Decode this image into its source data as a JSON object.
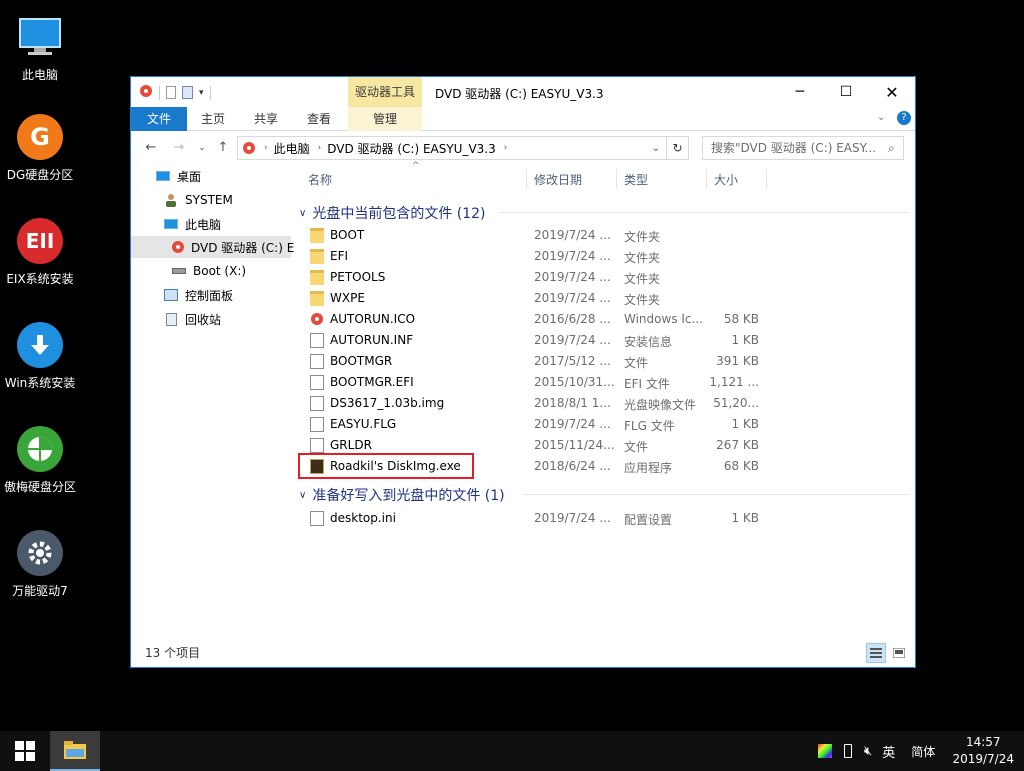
{
  "desktop": {
    "icons": [
      {
        "label": "此电脑",
        "icon": "this-pc-icon"
      },
      {
        "label": "DG硬盘分区",
        "icon": "dg-partition-icon"
      },
      {
        "label": "EIX系统安装",
        "icon": "eix-install-icon"
      },
      {
        "label": "Win系统安装",
        "icon": "win-install-icon"
      },
      {
        "label": "傲梅硬盘分区",
        "icon": "aomei-partition-icon"
      },
      {
        "label": "万能驱动7",
        "icon": "driver-gear-icon"
      }
    ]
  },
  "window": {
    "title": "DVD 驱动器 (C:) EASYU_V3.3",
    "context_tab": "驱动器工具",
    "ribbon_tabs": [
      "文件",
      "主页",
      "共享",
      "查看",
      "管理"
    ],
    "address": {
      "crumbs": [
        "此电脑",
        "DVD 驱动器 (C:) EASYU_V3.3"
      ]
    },
    "search_placeholder": "搜索\"DVD 驱动器 (C:) EASY...",
    "nav": [
      {
        "label": "桌面",
        "icon": "desktop-icon"
      },
      {
        "label": "SYSTEM",
        "icon": "user-icon"
      },
      {
        "label": "此电脑",
        "icon": "this-pc-icon"
      },
      {
        "label": "DVD 驱动器 (C:) E",
        "icon": "dvd-drive-icon"
      },
      {
        "label": "Boot (X:)",
        "icon": "drive-icon"
      },
      {
        "label": "控制面板",
        "icon": "control-panel-icon"
      },
      {
        "label": "回收站",
        "icon": "recycle-bin-icon"
      }
    ],
    "columns": {
      "name": "名称",
      "date": "修改日期",
      "type": "类型",
      "size": "大小"
    },
    "groups": [
      {
        "label": "光盘中当前包含的文件 (12)",
        "files": [
          {
            "name": "BOOT",
            "date": "2019/7/24 ...",
            "type": "文件夹",
            "size": "",
            "kind": "folder"
          },
          {
            "name": "EFI",
            "date": "2019/7/24 ...",
            "type": "文件夹",
            "size": "",
            "kind": "folder"
          },
          {
            "name": "PETOOLS",
            "date": "2019/7/24 ...",
            "type": "文件夹",
            "size": "",
            "kind": "folder"
          },
          {
            "name": "WXPE",
            "date": "2019/7/24 ...",
            "type": "文件夹",
            "size": "",
            "kind": "folder"
          },
          {
            "name": "AUTORUN.ICO",
            "date": "2016/6/28 ...",
            "type": "Windows Ic...",
            "size": "58 KB",
            "kind": "ico"
          },
          {
            "name": "AUTORUN.INF",
            "date": "2019/7/24 ...",
            "type": "安装信息",
            "size": "1 KB",
            "kind": "doc"
          },
          {
            "name": "BOOTMGR",
            "date": "2017/5/12 ...",
            "type": "文件",
            "size": "391 KB",
            "kind": "doc"
          },
          {
            "name": "BOOTMGR.EFI",
            "date": "2015/10/31...",
            "type": "EFI 文件",
            "size": "1,121 ...",
            "kind": "doc"
          },
          {
            "name": "DS3617_1.03b.img",
            "date": "2018/8/1 1...",
            "type": "光盘映像文件",
            "size": "51,20...",
            "kind": "doc"
          },
          {
            "name": "EASYU.FLG",
            "date": "2019/7/24 ...",
            "type": "FLG 文件",
            "size": "1 KB",
            "kind": "doc"
          },
          {
            "name": "GRLDR",
            "date": "2015/11/24...",
            "type": "文件",
            "size": "267 KB",
            "kind": "doc"
          },
          {
            "name": "Roadkil's DiskImg.exe",
            "date": "2018/6/24 ...",
            "type": "应用程序",
            "size": "68 KB",
            "kind": "exe"
          }
        ]
      },
      {
        "label": "准备好写入到光盘中的文件 (1)",
        "files": [
          {
            "name": "desktop.ini",
            "date": "2019/7/24 ...",
            "type": "配置设置",
            "size": "1 KB",
            "kind": "doc"
          }
        ]
      }
    ],
    "status": "13 个项目"
  },
  "taskbar": {
    "ime": "英",
    "lang": "简体",
    "time": "14:57",
    "date": "2019/7/24"
  },
  "colors": {
    "accent": "#1979ca",
    "highlight": "#e81c24",
    "group_text": "#1e3287",
    "context_tab": "#f7e8a1"
  }
}
